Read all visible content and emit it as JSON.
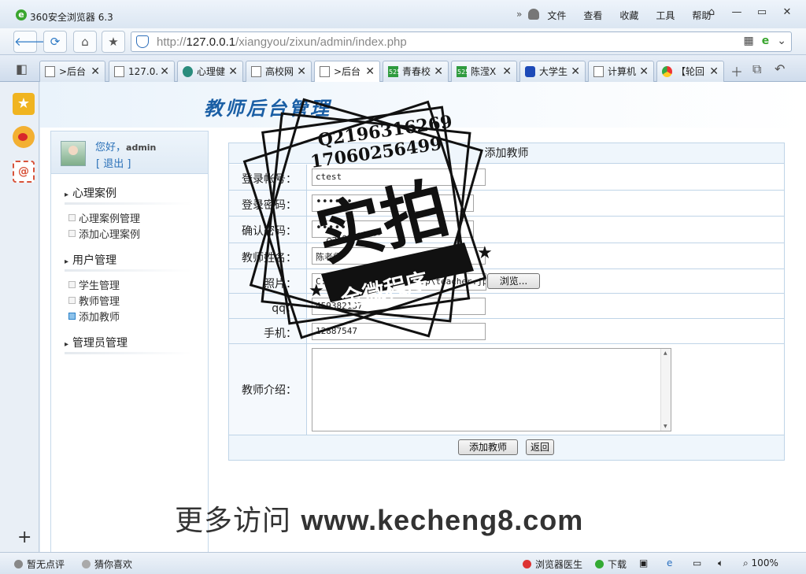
{
  "window": {
    "title": "360安全浏览器 6.3",
    "menu": [
      "文件",
      "查看",
      "收藏",
      "工具",
      "帮助"
    ],
    "controls": [
      "minimize",
      "maximize",
      "close"
    ]
  },
  "address": {
    "url_prefix": "http://",
    "url_host": "127.0.0.1",
    "url_path": "/xiangyou/zixun/admin/index.php"
  },
  "tabs": [
    {
      "label": ">后台"
    },
    {
      "label": "127.0."
    },
    {
      "label": "心理健"
    },
    {
      "label": "高校网"
    },
    {
      "label": ">后台"
    },
    {
      "label": "青春校"
    },
    {
      "label": "陈滢X"
    },
    {
      "label": "大学生"
    },
    {
      "label": "计算机"
    },
    {
      "label": "【轮回"
    }
  ],
  "page": {
    "banner_title": "教师后台管理",
    "user": {
      "greeting": "您好，",
      "name": "admin",
      "logout": "[ 退出 ]"
    },
    "nav": {
      "group1": "心理案例",
      "group1_items": [
        "心理案例管理",
        "添加心理案例"
      ],
      "group2": "用户管理",
      "group2_items": [
        "学生管理",
        "教师管理",
        "添加教师"
      ],
      "group3": "管理员管理"
    },
    "form": {
      "title": "添加教师",
      "account_label": "登录帐号：",
      "account_value": "ctest",
      "password_label": "登录密码：",
      "password_value": "••••••",
      "confirm_label": "确认密码：",
      "confirm_value": "••••••",
      "name_label": "教师姓名：",
      "name_value": "陈老师",
      "photo_label": "照片：",
      "photo_value": "C:\\Users\\admin\\Desktop\\teacher.jpg",
      "browse_label": "浏览...",
      "qq_label": "qq：",
      "qq_value": "459382137",
      "phone_label": "手机：",
      "phone_value": "12887547",
      "intro_label": "教师介绍：",
      "submit_label": "添加教师",
      "back_label": "返回"
    }
  },
  "overlay": {
    "watermark_prefix": "更多访问 ",
    "watermark_site": "www.kecheng8.com",
    "stamp_qq": "Q2196316269",
    "stamp_phone": "17060256499",
    "stamp_main": "实拍",
    "stamp_ribbon": "全微程序"
  },
  "status": {
    "rating": "暂无点评",
    "guess": "猜你喜欢",
    "doctor": "浏览器医生",
    "download": "下载",
    "zoom": "100%"
  }
}
